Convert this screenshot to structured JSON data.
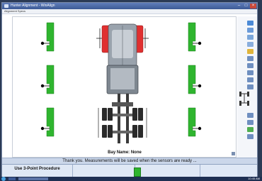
{
  "window": {
    "title": "Hunter Alignment - WinAlign",
    "menu": "Alignment Specs",
    "min": "–",
    "max": "□",
    "close": "×"
  },
  "bay": {
    "label": "Bay Name: None"
  },
  "status": {
    "message": "Thank you.  Measurements will be saved when the sensors are ready ..."
  },
  "buttons": {
    "b1": "Use 3-Point Procedure",
    "b2": "",
    "b3": "",
    "b4": ""
  },
  "taskbar": {
    "clock": "10:45 AM"
  },
  "colors": {
    "sensor": "#2fb52f",
    "accent": "#d92b2b"
  }
}
